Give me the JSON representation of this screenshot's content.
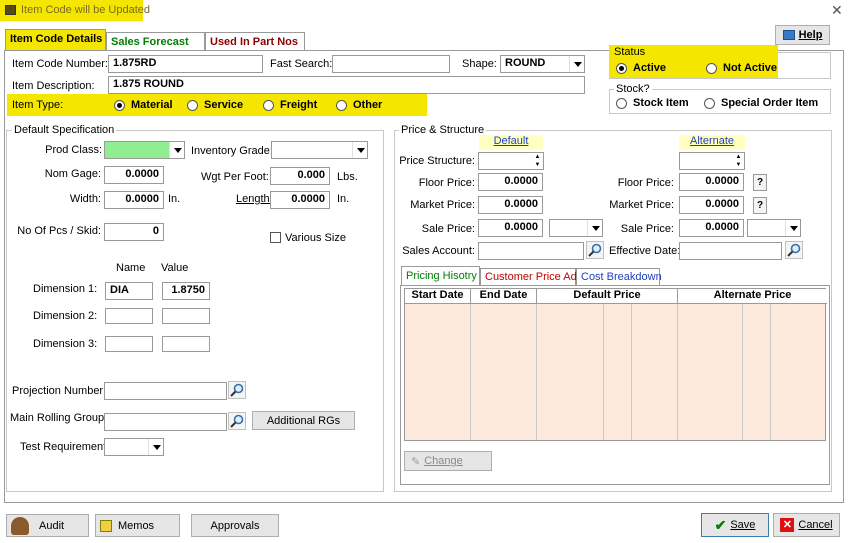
{
  "window": {
    "title": "Item Code will be Updated"
  },
  "tabs": [
    {
      "label": "Item Code Details",
      "color": "#000000"
    },
    {
      "label": "Sales Forecast",
      "color": "#008000"
    },
    {
      "label": "Used In Part Nos",
      "color": "#8b0000"
    }
  ],
  "help": {
    "label": "Help"
  },
  "header": {
    "item_code_label": "Item Code Number:",
    "item_code_value": "1.875RD",
    "fast_search_label": "Fast Search:",
    "fast_search_value": "",
    "shape_label": "Shape:",
    "shape_value": "ROUND",
    "desc_label": "Item Description:",
    "desc_value": "1.875 ROUND",
    "item_type_label": "Item Type:",
    "item_types": [
      "Material",
      "Service",
      "Freight",
      "Other"
    ],
    "item_type_selected": "Material"
  },
  "status": {
    "title": "Status",
    "options": [
      "Active",
      "Not Active"
    ],
    "selected": "Active"
  },
  "stock": {
    "title": "Stock?",
    "options": [
      "Stock Item",
      "Special Order Item"
    ],
    "selected": ""
  },
  "spec": {
    "title": "Default Specification",
    "prod_class_label": "Prod Class:",
    "prod_class_color": "#90ee90",
    "inventory_grade_label": "Inventory Grade:",
    "nom_gage_label": "Nom Gage:",
    "nom_gage_value": "0.0000",
    "wgt_label": "Wgt Per Foot:",
    "wgt_value": "0.000",
    "wgt_unit": "Lbs.",
    "width_label": "Width:",
    "width_value": "0.0000",
    "width_unit": "In.",
    "length_label": "Length:",
    "length_value": "0.0000",
    "length_unit": "In.",
    "pcs_label": "No Of Pcs / Skid:",
    "pcs_value": "0",
    "various_size_label": "Various Size",
    "dim_name_header": "Name",
    "dim_value_header": "Value",
    "dims": [
      {
        "label": "Dimension 1:",
        "name": "DIA",
        "value": "1.8750"
      },
      {
        "label": "Dimension 2:",
        "name": "",
        "value": ""
      },
      {
        "label": "Dimension 3:",
        "name": "",
        "value": ""
      }
    ],
    "projection_label": "Projection Number:",
    "rolling_label": "Main Rolling Group:",
    "additional_rgs_label": "Additional RGs",
    "test_req_label": "Test Requirement:"
  },
  "pricing": {
    "title": "Price & Structure",
    "default_header": "Default",
    "alternate_header": "Alternate",
    "price_structure_label": "Price Structure:",
    "floor_label": "Floor Price:",
    "market_label": "Market Price:",
    "sale_label": "Sale Price:",
    "default_floor": "0.0000",
    "default_market": "0.0000",
    "default_sale": "0.0000",
    "alt_floor": "0.0000",
    "alt_market": "0.0000",
    "alt_sale": "0.0000",
    "sales_account_label": "Sales Account:",
    "effective_date_label": "Effective Date:"
  },
  "history_tabs": [
    {
      "label": "Pricing Hisotry",
      "color": "#008000"
    },
    {
      "label": "Customer Price Adj",
      "color": "#c00000"
    },
    {
      "label": "Cost Breakdown",
      "color": "#1f3fbf"
    }
  ],
  "grid_headers": [
    "Start Date",
    "End Date",
    "Default Price",
    "Alternate Price"
  ],
  "change": {
    "label": "Change"
  },
  "bottom": {
    "audit": "Audit",
    "memos": "Memos",
    "approvals": "Approvals",
    "save": "Save",
    "cancel": "Cancel"
  }
}
